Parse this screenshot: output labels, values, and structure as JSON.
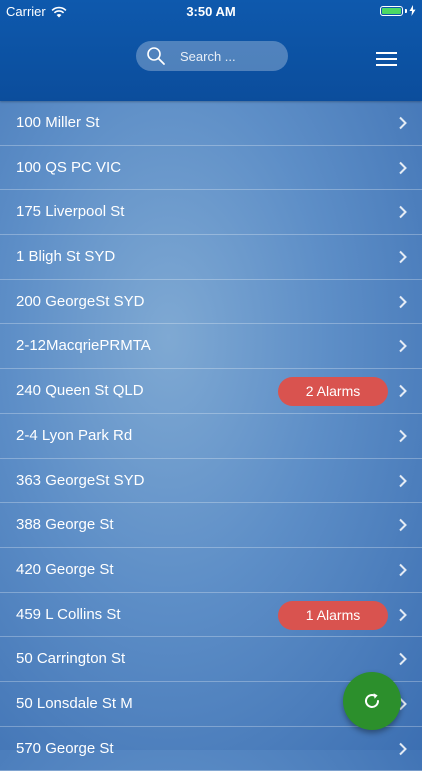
{
  "status_bar": {
    "carrier": "Carrier",
    "time": "3:50 AM"
  },
  "header": {
    "search_placeholder": "Search ..."
  },
  "sites": [
    {
      "name": "100 Miller St",
      "badge": null
    },
    {
      "name": "100 QS PC VIC",
      "badge": null
    },
    {
      "name": "175 Liverpool St",
      "badge": null
    },
    {
      "name": "1 Bligh St SYD",
      "badge": null
    },
    {
      "name": "200 GeorgeSt SYD",
      "badge": null
    },
    {
      "name": "2-12MacqriePRMTA",
      "badge": null
    },
    {
      "name": "240 Queen St QLD",
      "badge": "2 Alarms"
    },
    {
      "name": "2-4 Lyon Park Rd",
      "badge": null
    },
    {
      "name": "363 GeorgeSt SYD",
      "badge": null
    },
    {
      "name": "388 George St",
      "badge": null
    },
    {
      "name": "420 George St",
      "badge": null
    },
    {
      "name": "459 L Collins St",
      "badge": "1 Alarms"
    },
    {
      "name": "50 Carrington St",
      "badge": null
    },
    {
      "name": "50 Lonsdale St M",
      "badge": null
    },
    {
      "name": "570 George St",
      "badge": null
    }
  ],
  "icons": {
    "wifi": "wifi-icon",
    "battery": "battery-icon",
    "search": "search-icon",
    "menu": "hamburger-menu-icon",
    "chevron": "chevron-right-icon",
    "refresh": "refresh-icon"
  },
  "colors": {
    "header": "#0b4d9c",
    "alarm_badge": "#d9534f",
    "refresh_button": "#2c8f2c",
    "battery_fill": "#4cd964"
  },
  "battery_level": 1.0
}
